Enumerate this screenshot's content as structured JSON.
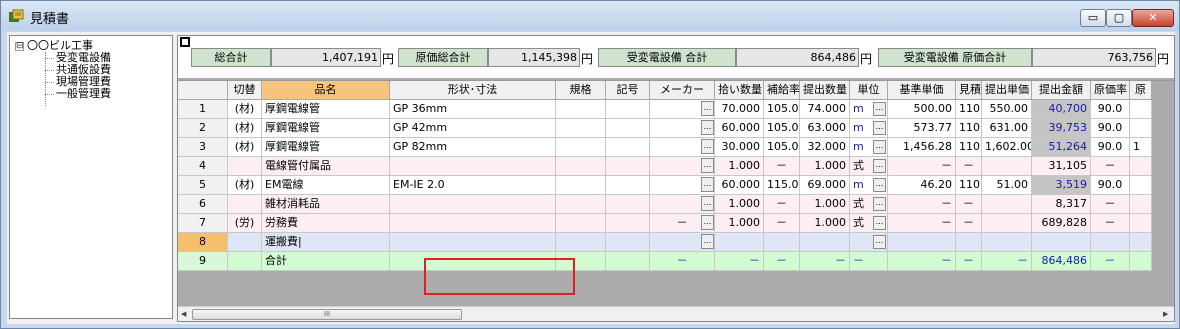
{
  "window": {
    "title": "見積書",
    "minimize": "▭",
    "maximize": "▢",
    "close": "✕"
  },
  "tree": {
    "expander": "⊟",
    "root": "〇〇ビル工事",
    "children": [
      "受変電設備",
      "共通仮設費",
      "現場管理費",
      "一般管理費"
    ]
  },
  "summary": {
    "total_label": "総合計",
    "total_value": "1,407,191",
    "cost_label": "原価総合計",
    "cost_value": "1,145,398",
    "section_label": "受変電設備 合計",
    "section_value": "864,486",
    "section_cost_label": "受変電設備 原価合計",
    "section_cost_value": "763,756",
    "yen": "円"
  },
  "columns": [
    "",
    "切替",
    "品名",
    "形状･寸法",
    "規格",
    "記号",
    "メーカー",
    "拾い数量",
    "補給率",
    "提出数量",
    "単位",
    "基準単価",
    "見積率",
    "提出単価",
    "提出金額",
    "原価率",
    "原"
  ],
  "rows": [
    {
      "no": "1",
      "kind": "(材)",
      "name": "厚鋼電線管",
      "spec": "GP 36mm",
      "std": "",
      "sym": "",
      "maker": "",
      "qty": "70.000",
      "rate": "105.0",
      "sqty": "74.000",
      "unit": "m",
      "base": "500.00",
      "est": "110.0",
      "sprice": "550.00",
      "amount": "40,700",
      "cost": "90.0",
      "extra": ""
    },
    {
      "no": "2",
      "kind": "(材)",
      "name": "厚鋼電線管",
      "spec": "GP 42mm",
      "std": "",
      "sym": "",
      "maker": "",
      "qty": "60.000",
      "rate": "105.0",
      "sqty": "63.000",
      "unit": "m",
      "base": "573.77",
      "est": "110.0",
      "sprice": "631.00",
      "amount": "39,753",
      "cost": "90.0",
      "extra": ""
    },
    {
      "no": "3",
      "kind": "(材)",
      "name": "厚鋼電線管",
      "spec": "GP 82mm",
      "std": "",
      "sym": "",
      "maker": "",
      "qty": "30.000",
      "rate": "105.0",
      "sqty": "32.000",
      "unit": "m",
      "base": "1,456.28",
      "est": "110.0",
      "sprice": "1,602.00",
      "amount": "51,264",
      "cost": "90.0",
      "extra": "1"
    },
    {
      "no": "4",
      "kind": "",
      "name": "電線管付属品",
      "spec": "",
      "std": "",
      "sym": "",
      "maker": "",
      "qty": "1.000",
      "rate": "－",
      "sqty": "1.000",
      "unit": "式",
      "base": "－",
      "est": "－",
      "sprice": "",
      "amount": "31,105",
      "cost": "－",
      "extra": ""
    },
    {
      "no": "5",
      "kind": "(材)",
      "name": "EM電線",
      "spec": "EM-IE 2.0",
      "std": "",
      "sym": "",
      "maker": "",
      "qty": "60.000",
      "rate": "115.0",
      "sqty": "69.000",
      "unit": "m",
      "base": "46.20",
      "est": "110.0",
      "sprice": "51.00",
      "amount": "3,519",
      "cost": "90.0",
      "extra": ""
    },
    {
      "no": "6",
      "kind": "",
      "name": "雑材消耗品",
      "spec": "",
      "std": "",
      "sym": "",
      "maker": "",
      "qty": "1.000",
      "rate": "－",
      "sqty": "1.000",
      "unit": "式",
      "base": "－",
      "est": "－",
      "sprice": "",
      "amount": "8,317",
      "cost": "－",
      "extra": ""
    },
    {
      "no": "7",
      "kind": "(労)",
      "name": "労務費",
      "spec": "",
      "std": "",
      "sym": "",
      "maker": "－",
      "qty": "1.000",
      "rate": "－",
      "sqty": "1.000",
      "unit": "式",
      "base": "－",
      "est": "－",
      "sprice": "",
      "amount": "689,828",
      "cost": "－",
      "extra": ""
    },
    {
      "no": "8",
      "kind": "",
      "name": "運搬費|",
      "spec": "",
      "std": "",
      "sym": "",
      "maker": "",
      "qty": "",
      "rate": "",
      "sqty": "",
      "unit": "",
      "base": "",
      "est": "",
      "sprice": "",
      "amount": "",
      "cost": "",
      "extra": ""
    },
    {
      "no": "9",
      "kind": "",
      "name": "合計",
      "spec": "",
      "std": "",
      "sym": "",
      "maker": "－",
      "qty": "－",
      "rate": "－",
      "sqty": "－",
      "unit": "－",
      "base": "－",
      "est": "－",
      "sprice": "－",
      "amount": "864,486",
      "cost": "－",
      "extra": ""
    }
  ],
  "ellipsis": "...",
  "scroll": {
    "left": "◀",
    "right": "▶",
    "grip": "III"
  }
}
